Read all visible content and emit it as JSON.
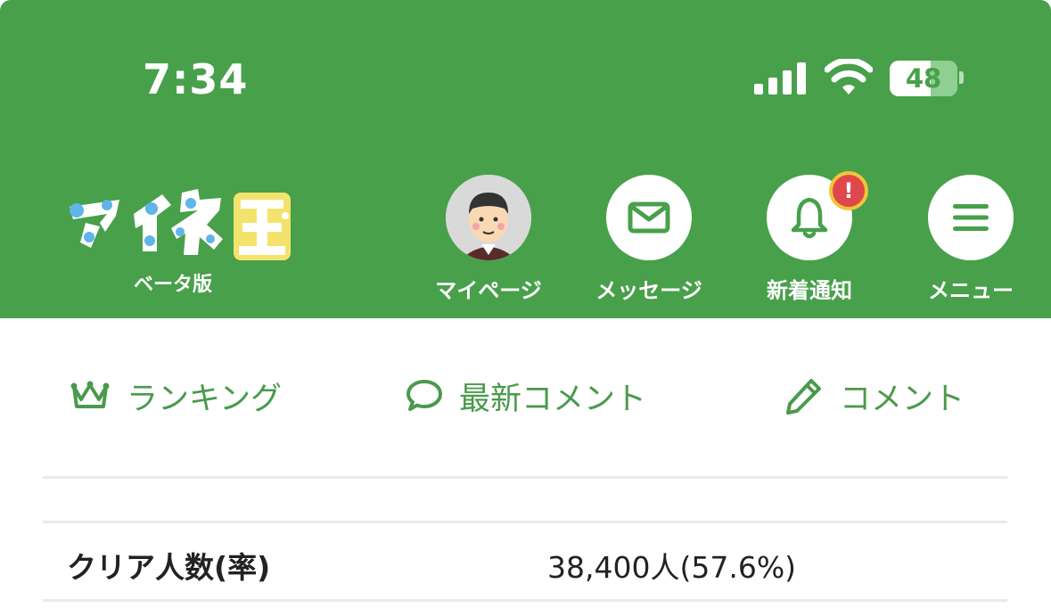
{
  "status_bar": {
    "time": "7:34",
    "battery": "48"
  },
  "header": {
    "logo_sub": "ベータ版",
    "nav": [
      {
        "label": "マイページ",
        "icon": "avatar"
      },
      {
        "label": "メッセージ",
        "icon": "mail-icon"
      },
      {
        "label": "新着通知",
        "icon": "bell-icon",
        "badge": "!"
      },
      {
        "label": "メニュー",
        "icon": "hamburger-menu-icon"
      }
    ]
  },
  "tabs": [
    {
      "label": "ランキング",
      "icon": "crown-icon"
    },
    {
      "label": "最新コメント",
      "icon": "speech-bubble-icon"
    },
    {
      "label": "コメント",
      "icon": "pencil-icon"
    }
  ],
  "stats": {
    "row_label": "クリア人数(率)",
    "row_value": "38,400人(57.6%)"
  },
  "colors": {
    "brand_green": "#48a04b",
    "badge_red": "#e0474c",
    "badge_ring": "#f0c53a"
  }
}
